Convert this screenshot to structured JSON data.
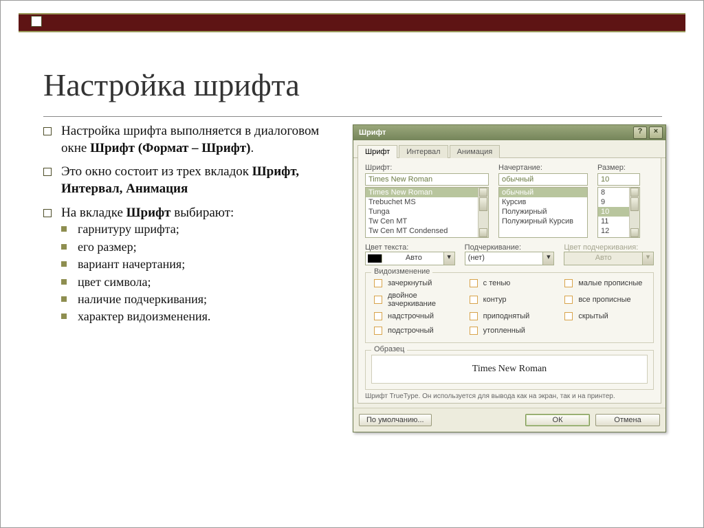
{
  "slide": {
    "title": "Настройка шрифта",
    "bullets": [
      {
        "html": "Настройка шрифта выполняется в диалоговом окне <b>Шрифт (Формат – Шрифт)</b>."
      },
      {
        "html": "Это окно состоит из трех вкладок <b>Шрифт, Интервал, Анимация</b>"
      },
      {
        "html": "На вкладке <b>Шрифт</b> выбирают:",
        "sub": [
          "гарнитуру шрифта;",
          "его размер;",
          "вариант начертания;",
          "цвет символа;",
          "наличие подчеркивания;",
          "характер видоизменения."
        ]
      }
    ]
  },
  "dialog": {
    "title": "Шрифт",
    "tabs": [
      "Шрифт",
      "Интервал",
      "Анимация"
    ],
    "labels": {
      "font": "Шрифт:",
      "style": "Начертание:",
      "size": "Размер:",
      "textColor": "Цвет текста:",
      "underline": "Подчеркивание:",
      "underlineColor": "Цвет подчеркивания:",
      "effects": "Видоизменение",
      "sample": "Образец"
    },
    "font": {
      "value": "Times New Roman",
      "options": [
        "Times New Roman",
        "Trebuchet MS",
        "Tunga",
        "Tw Cen MT",
        "Tw Cen MT Condensed"
      ]
    },
    "style": {
      "value": "обычный",
      "options": [
        "обычный",
        "Курсив",
        "Полужирный",
        "Полужирный Курсив"
      ]
    },
    "size": {
      "value": "10",
      "options": [
        "8",
        "9",
        "10",
        "11",
        "12"
      ]
    },
    "textColor": "Авто",
    "underline": "(нет)",
    "underlineColor": "Авто",
    "effects": [
      "зачеркнутый",
      "с тенью",
      "малые прописные",
      "двойное зачеркивание",
      "контур",
      "все прописные",
      "надстрочный",
      "приподнятый",
      "скрытый",
      "подстрочный",
      "утопленный"
    ],
    "sampleText": "Times New Roman",
    "hint": "Шрифт TrueType. Он используется для вывода как на экран, так и на принтер.",
    "buttons": {
      "default": "По умолчанию...",
      "ok": "ОК",
      "cancel": "Отмена"
    }
  }
}
